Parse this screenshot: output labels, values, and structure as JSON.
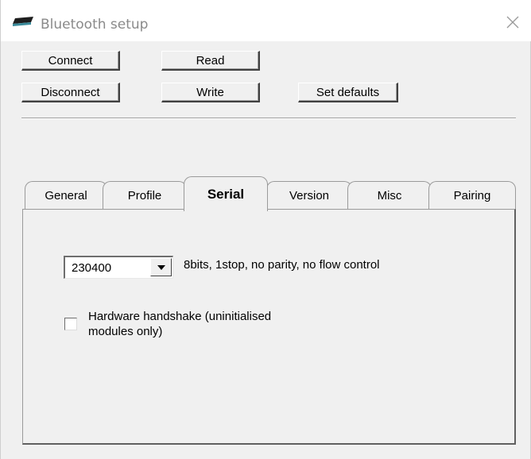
{
  "window": {
    "title": "Bluetooth setup",
    "icon": "device-icon",
    "close_icon": "close-icon"
  },
  "toolbar": {
    "connect_label": "Connect",
    "disconnect_label": "Disconnect",
    "read_label": "Read",
    "write_label": "Write",
    "set_defaults_label": "Set defaults"
  },
  "tabs": [
    {
      "label": "General",
      "active": false
    },
    {
      "label": "Profile",
      "active": false
    },
    {
      "label": "Serial",
      "active": true
    },
    {
      "label": "Version",
      "active": false
    },
    {
      "label": "Misc",
      "active": false
    },
    {
      "label": "Pairing",
      "active": false
    }
  ],
  "serial": {
    "baud_rate": "230400",
    "description": "8bits, 1stop, no parity, no flow control",
    "hardware_handshake_label_line1": "Hardware handshake (uninitialised",
    "hardware_handshake_label_line2": "modules only)",
    "hardware_handshake_checked": false
  }
}
